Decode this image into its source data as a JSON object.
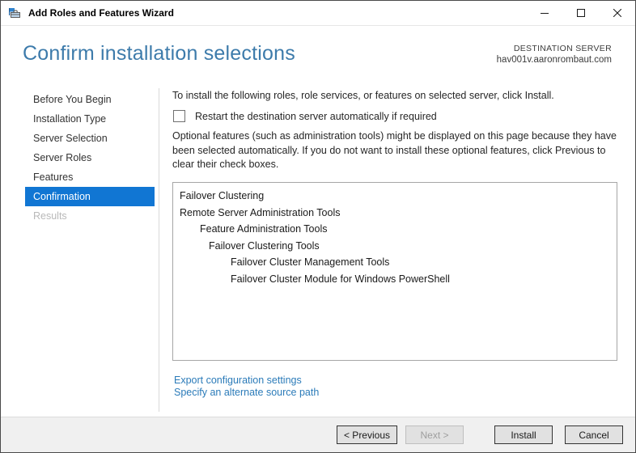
{
  "window": {
    "title": "Add Roles and Features Wizard"
  },
  "header": {
    "title": "Confirm installation selections",
    "destination_label": "DESTINATION SERVER",
    "destination_server": "hav001v.aaronrombaut.com"
  },
  "sidebar": {
    "items": [
      {
        "id": "before-you-begin",
        "label": "Before You Begin",
        "state": "normal"
      },
      {
        "id": "installation-type",
        "label": "Installation Type",
        "state": "normal"
      },
      {
        "id": "server-selection",
        "label": "Server Selection",
        "state": "normal"
      },
      {
        "id": "server-roles",
        "label": "Server Roles",
        "state": "normal"
      },
      {
        "id": "features",
        "label": "Features",
        "state": "normal"
      },
      {
        "id": "confirmation",
        "label": "Confirmation",
        "state": "selected"
      },
      {
        "id": "results",
        "label": "Results",
        "state": "disabled"
      }
    ]
  },
  "main": {
    "intro": "To install the following roles, role services, or features on selected server, click Install.",
    "restart_checkbox": {
      "label": "Restart the destination server automatically if required",
      "checked": false
    },
    "note": "Optional features (such as administration tools) might be displayed on this page because they have been selected automatically. If you do not want to install these optional features, click Previous to clear their check boxes.",
    "features": [
      {
        "label": "Failover Clustering",
        "indent": 0
      },
      {
        "label": "Remote Server Administration Tools",
        "indent": 0
      },
      {
        "label": "Feature Administration Tools",
        "indent": 1
      },
      {
        "label": "Failover Clustering Tools",
        "indent": 2
      },
      {
        "label": "Failover Cluster Management Tools",
        "indent": 3
      },
      {
        "label": "Failover Cluster Module for Windows PowerShell",
        "indent": 3
      }
    ],
    "links": [
      {
        "id": "export-configuration-settings",
        "label": "Export configuration settings"
      },
      {
        "id": "specify-alternate-source-path",
        "label": "Specify an alternate source path"
      }
    ]
  },
  "footer": {
    "buttons": [
      {
        "id": "previous",
        "label": "< Previous",
        "enabled": true
      },
      {
        "id": "next",
        "label": "Next >",
        "enabled": false
      },
      {
        "id": "install",
        "label": "Install",
        "enabled": true
      },
      {
        "id": "cancel",
        "label": "Cancel",
        "enabled": true
      }
    ]
  },
  "colors": {
    "nav_selected_bg": "#1176d3",
    "nav_selected_text": "#ffffff",
    "heading": "#3d7bab",
    "link": "#2b7bb9",
    "footer_bg": "#f0f0f0",
    "button_bg": "#e1e1e1",
    "button_border": "#333333",
    "disabled_text": "#9e9e9e"
  }
}
